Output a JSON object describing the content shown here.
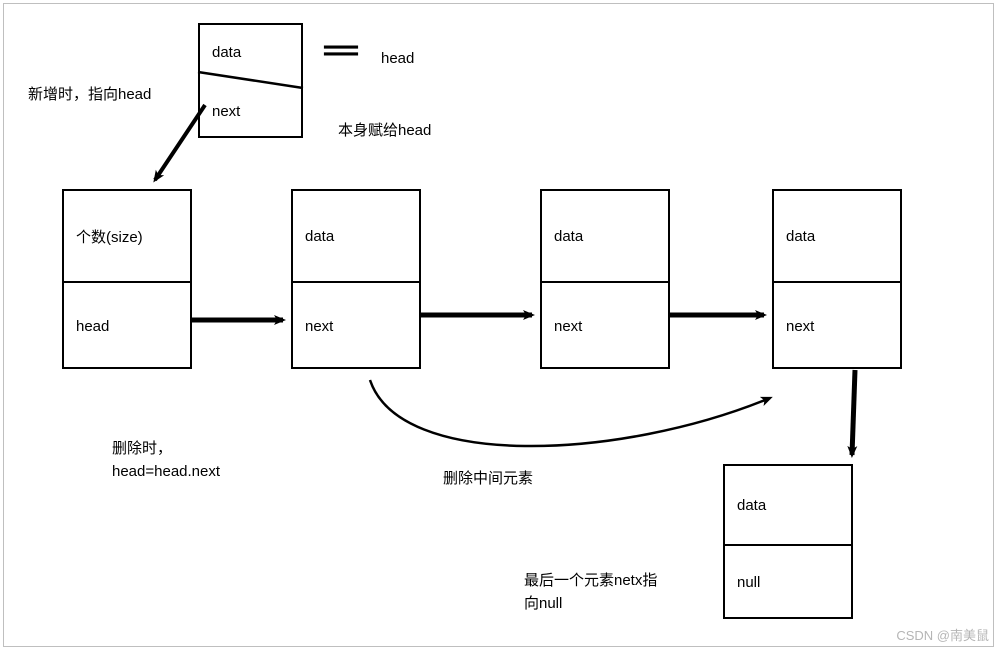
{
  "top_node": {
    "top": "data",
    "bottom": "next"
  },
  "equals_sign": "＝",
  "head_label": "head",
  "new_insert_label": "新增时，指向head",
  "assign_label": "本身赋给head",
  "list_head": {
    "top": "个数(size)",
    "bottom": "head"
  },
  "node1": {
    "top": "data",
    "bottom": "next"
  },
  "node2": {
    "top": "data",
    "bottom": "next"
  },
  "node3": {
    "top": "data",
    "bottom": "next"
  },
  "tail_node": {
    "top": "data",
    "bottom": "null"
  },
  "delete_head_label": "删除时，\nhead=head.next",
  "delete_mid_label": "删除中间元素",
  "last_null_label": "最后一个元素netx指\n向null",
  "watermark": "CSDN @南美鼠"
}
